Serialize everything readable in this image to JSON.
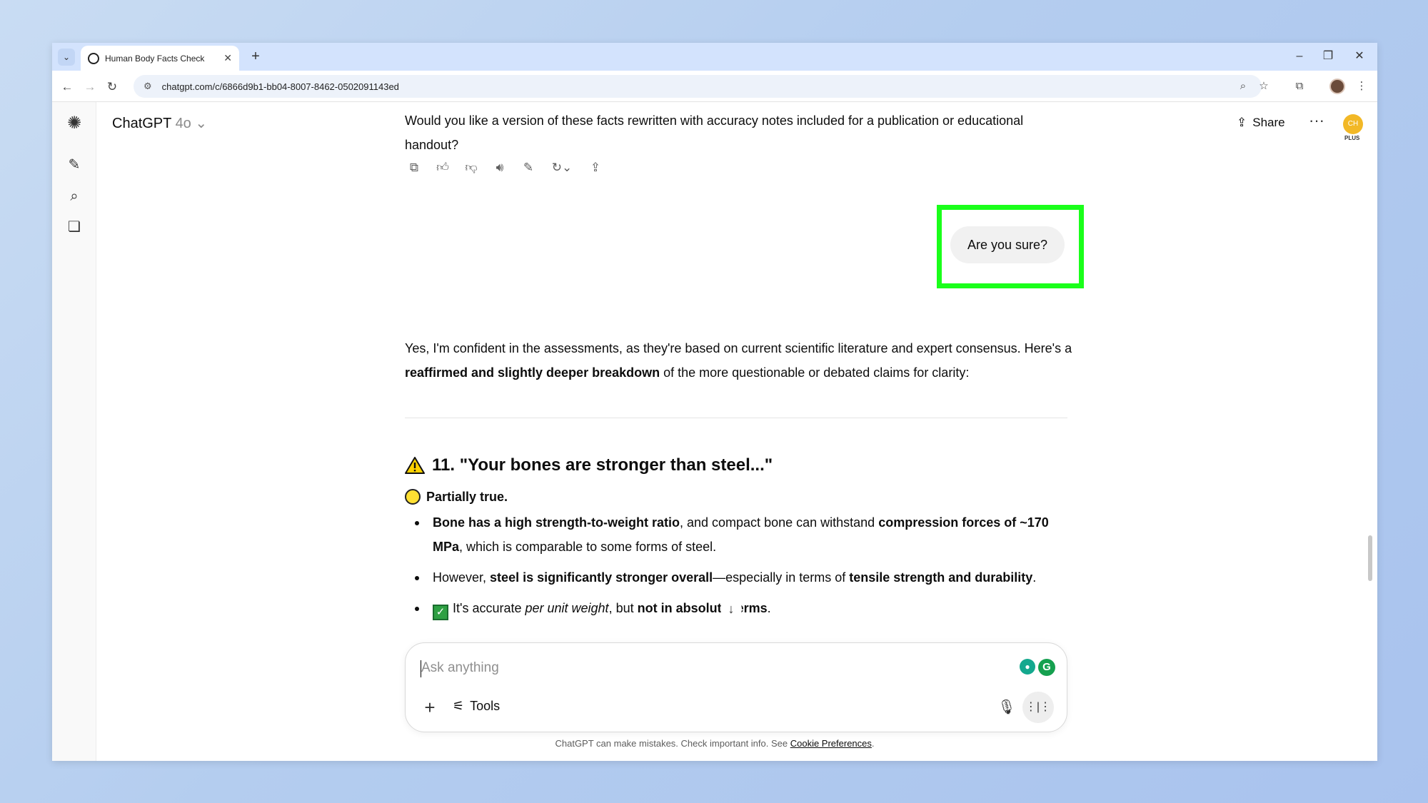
{
  "browser": {
    "tab_title": "Human Body Facts Check",
    "url": "chatgpt.com/c/6866d9b1-bb04-8007-8462-0502091143ed"
  },
  "header": {
    "app_name": "ChatGPT",
    "model_version": "4o",
    "share_label": "Share",
    "avatar_initials": "CH",
    "plan_badge": "PLUS"
  },
  "conversation": {
    "prev_message": "Would you like a version of these facts rewritten with accuracy notes included for a publication or educational handout?",
    "user_message": "Are you sure?",
    "reply_intro_a": "Yes, I'm confident in the assessments, as they're based on current scientific literature and expert consensus. Here's a ",
    "reply_intro_bold": "reaffirmed and slightly deeper breakdown",
    "reply_intro_b": " of the more questionable or debated claims for clarity:",
    "section_heading": "11. \"Your bones are stronger than steel...\"",
    "verdict": "Partially true.",
    "b1_bold1": "Bone has a high strength-to-weight ratio",
    "b1_text1": ", and compact bone can withstand ",
    "b1_bold2": "compression forces of ~170 MPa",
    "b1_text2": ", which is comparable to some forms of steel.",
    "b2_text1": "However, ",
    "b2_bold1": "steel is significantly stronger overall",
    "b2_text2": "—especially in terms of ",
    "b2_bold2": "tensile strength and durability",
    "b2_text3": ".",
    "b3_text1": "It's accurate ",
    "b3_italic": "per unit weight",
    "b3_text2": ", but ",
    "b3_bold": "not in absolute terms",
    "b3_text3": "."
  },
  "composer": {
    "placeholder": "Ask anything",
    "tools_label": "Tools"
  },
  "footer": {
    "disclaimer": "ChatGPT can make mistakes. Check important info. See ",
    "link": "Cookie Preferences",
    "end": "."
  }
}
